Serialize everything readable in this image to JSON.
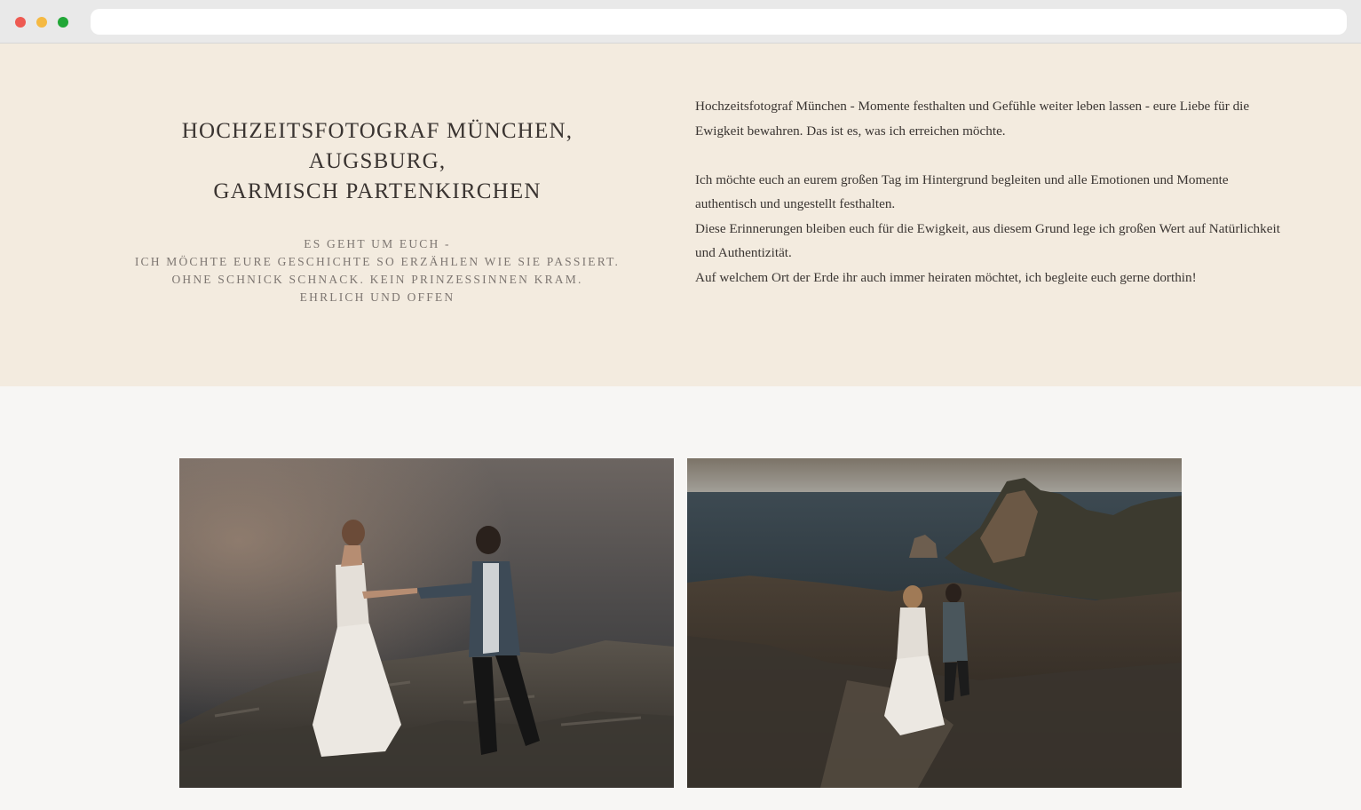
{
  "browser": {
    "url": "",
    "colors": {
      "close": "#ee5a52",
      "minimize": "#f5b942",
      "maximize": "#21a737"
    }
  },
  "colors": {
    "intro_background": "#f3ebdf",
    "page_background": "#f7f6f4",
    "title_color": "#3a3431"
  },
  "intro": {
    "title": "HOCHZEITSFOTOGRAF MÜNCHEN,\nAUGSBURG,\nGARMISCH PARTENKIRCHEN",
    "subtitle": "ES GEHT UM EUCH -\nICH MÖCHTE EURE GESCHICHTE SO ERZÄHLEN WIE SIE PASSIERT.\nOHNE SCHNICK SCHNACK. KEIN PRINZESSINNEN KRAM.\nEHRLICH UND OFFEN",
    "paragraphs": [
      "Hochzeitsfotograf München - Momente festhalten und Gefühle weiter leben lassen - eure Liebe für die Ewigkeit bewahren. Das ist es, was ich erreichen möchte.",
      "Ich möchte euch an eurem großen Tag im Hintergrund begleiten und alle Emotionen und Momente authentisch und ungestellt festhalten.",
      "Diese Erinnerungen bleiben euch für die Ewigkeit, aus diesem Grund lege ich großen Wert auf Natürlichkeit und Authentizität.",
      "Auf welchem Ort der Erde ihr auch immer heiraten möchtet, ich begleite euch gerne dorthin!"
    ]
  },
  "gallery": {
    "photos": [
      {
        "icon": "couple-on-cliff-photo"
      },
      {
        "icon": "couple-walking-coast-photo"
      }
    ]
  }
}
